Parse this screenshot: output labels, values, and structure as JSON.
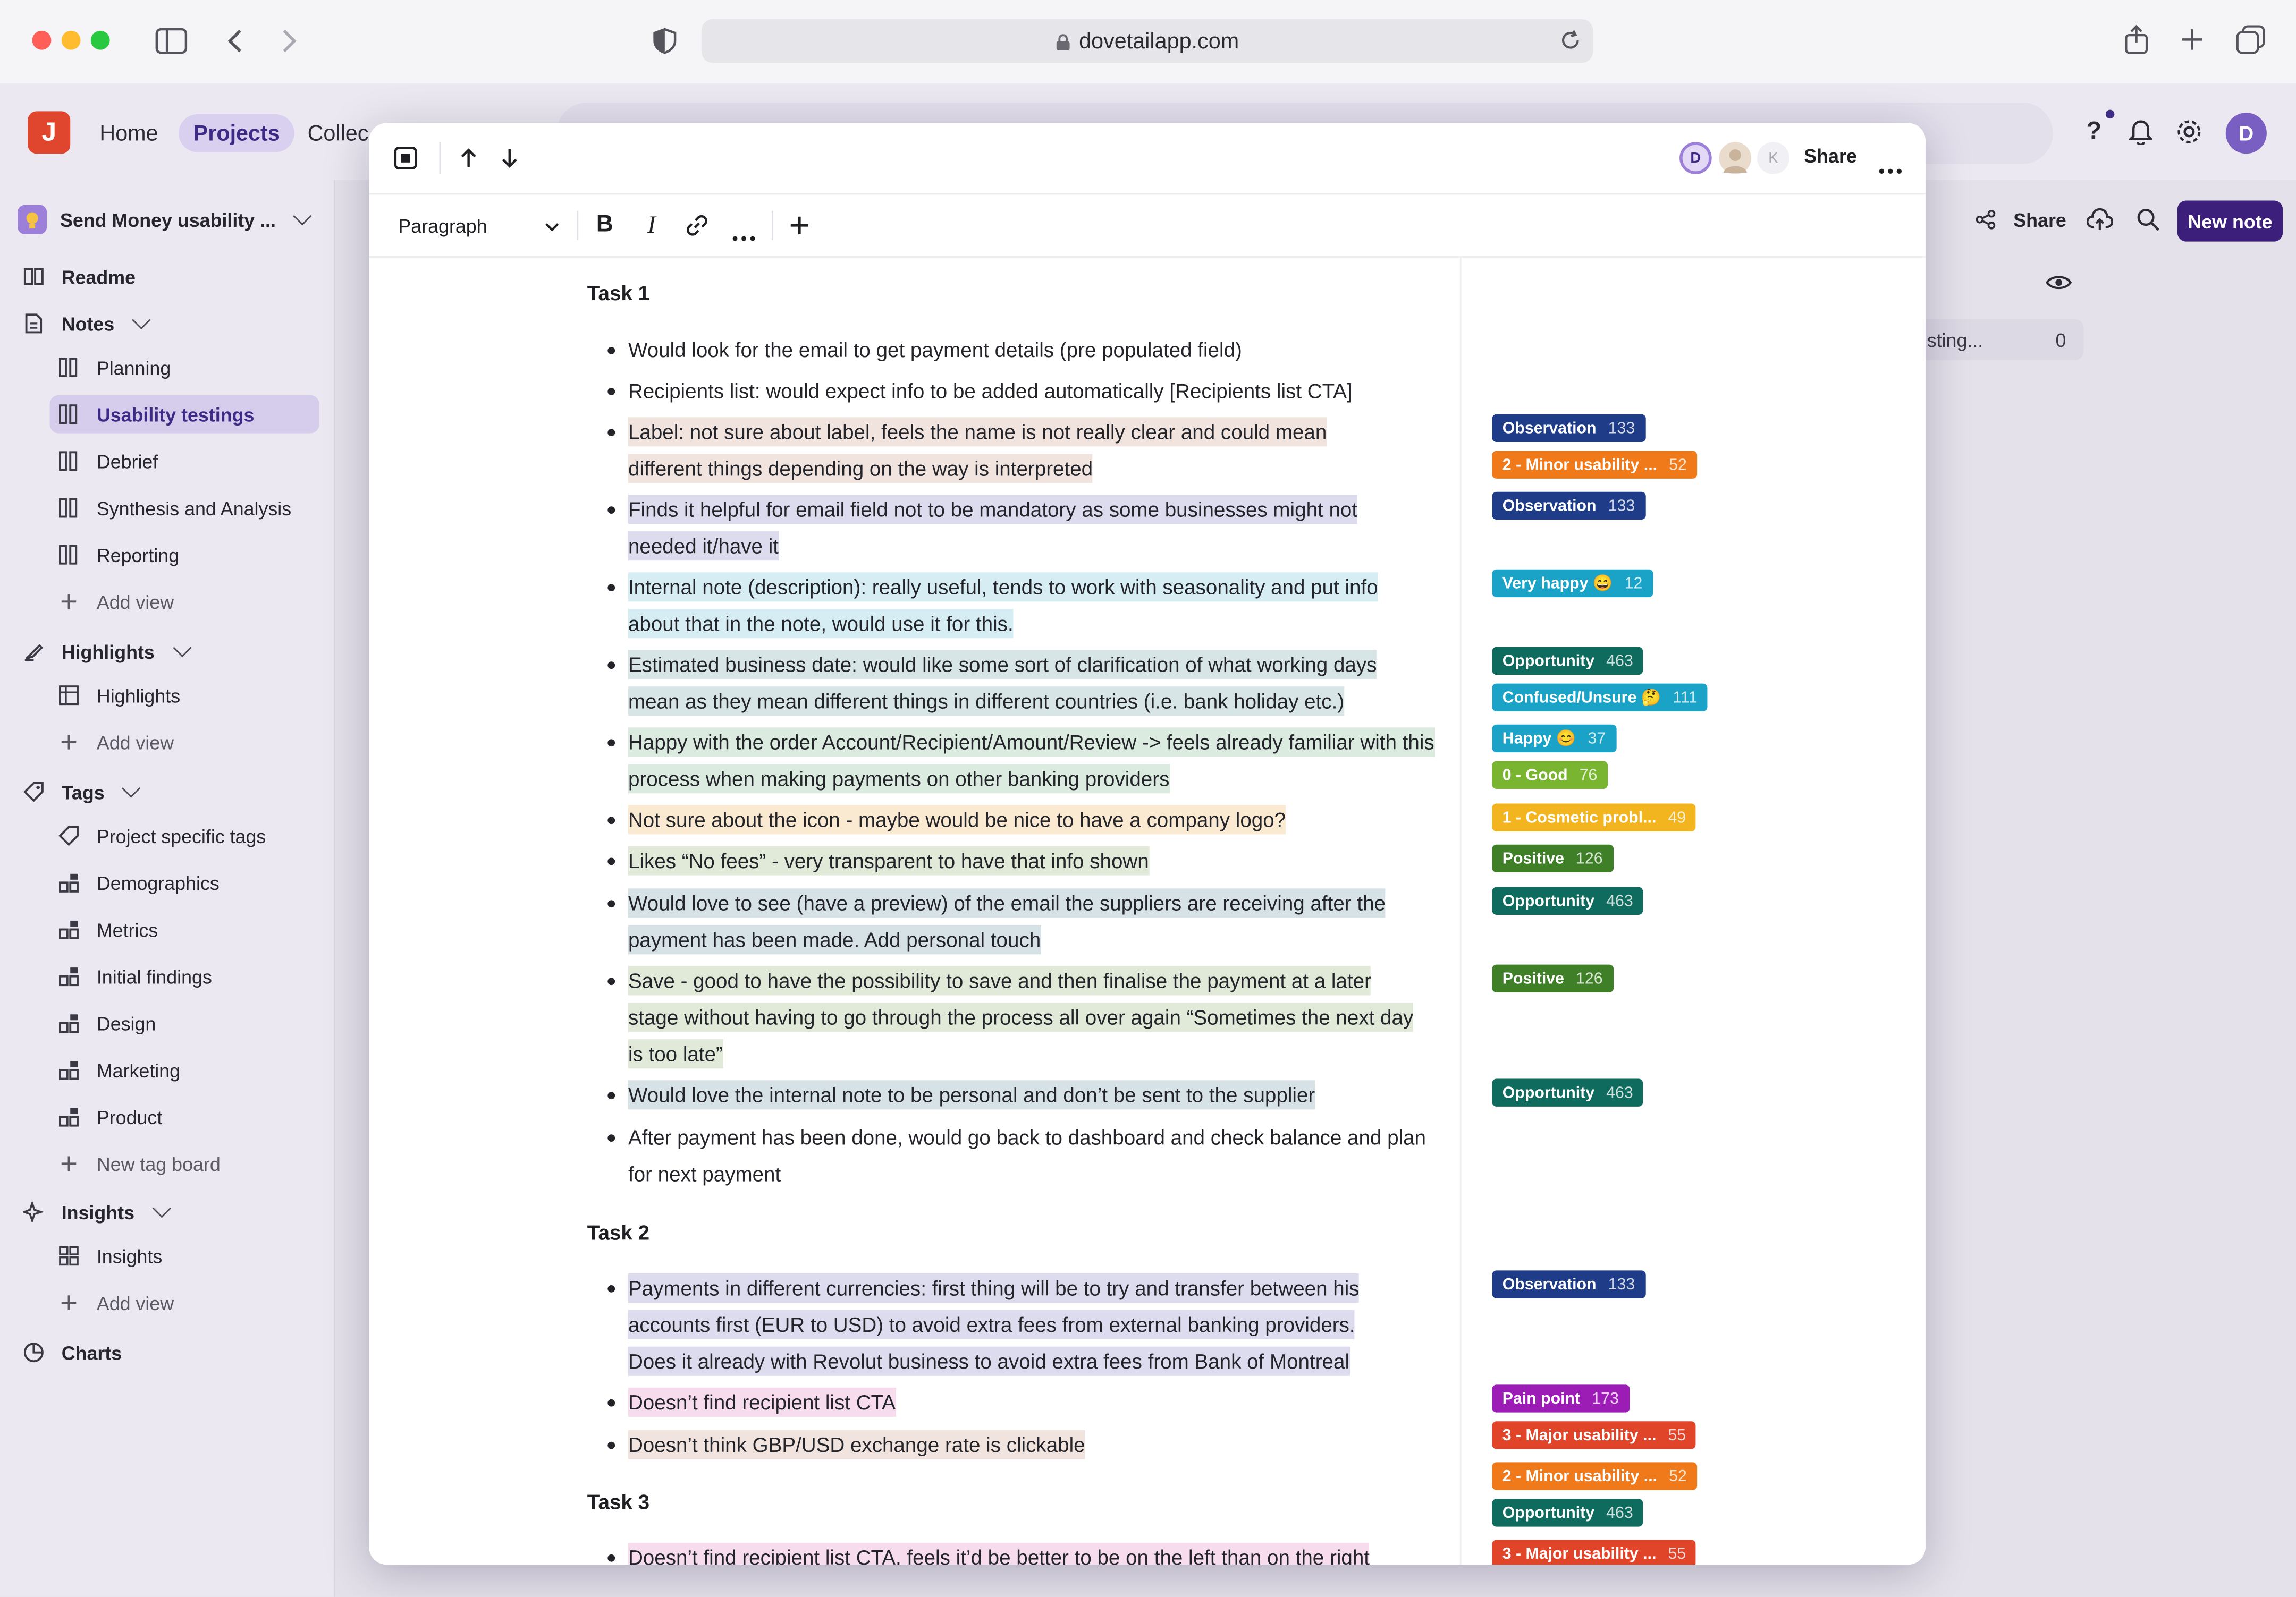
{
  "browser": {
    "url": "dovetailapp.com"
  },
  "app": {
    "logo_letter": "J",
    "nav": [
      "Home",
      "Projects",
      "Collec"
    ],
    "project_name": "Send Money usability ...",
    "actions": {
      "share": "Share",
      "new_note": "New note"
    },
    "avatar": "D",
    "bg_row": {
      "label": "sting...",
      "count": "0"
    }
  },
  "sidebar": {
    "readme": "Readme",
    "notes": "Notes",
    "note_views": [
      "Planning",
      "Usability testings",
      "Debrief",
      "Synthesis and Analysis",
      "Reporting"
    ],
    "add_view": "Add view",
    "highlights": "Highlights",
    "highlight_views": [
      "Highlights"
    ],
    "tags": "Tags",
    "tag_boards": [
      "Project specific tags",
      "Demographics",
      "Metrics",
      "Initial findings",
      "Design",
      "Marketing",
      "Product"
    ],
    "new_tag_board": "New tag board",
    "insights": "Insights",
    "insight_views": [
      "Insights"
    ],
    "charts": "Charts"
  },
  "modal": {
    "avatars": [
      "D",
      "",
      "K"
    ],
    "share": "Share",
    "format_select": "Paragraph"
  },
  "doc": {
    "task1": "Task 1",
    "task2": "Task 2",
    "task3": "Task 3",
    "items": [
      "Would look for the email to get payment details (pre populated field)",
      "Recipients list: would expect info to be added automatically [Recipients list CTA]",
      "Label: not sure about label, feels the name is not really clear and could mean different things depending on the way is interpreted",
      "Finds it helpful for email field not to be mandatory as some businesses might not needed it/have it",
      "Internal note (description): really useful, tends to work with seasonality and put info about that in the note, would use it for this.",
      "Estimated business date: would like some sort of clarification of what working days mean as they mean different things in different countries (i.e. bank holiday etc.)",
      "Happy with the order Account/Recipient/Amount/Review -> feels already familiar with this process when making payments on other banking providers",
      "Not sure about the icon - maybe would be nice to have a company logo?",
      "Likes “No fees” - very transparent to have that info shown",
      "Would love to see (have a preview) of the email the suppliers are receiving after the payment has been made. Add personal touch",
      "Save - good to have the possibility to save and then finalise the payment at a later stage without having to go through the process all over again “Sometimes the next day is too late”",
      "Would love the internal note to be personal and don’t be sent to the supplier",
      "After payment has been done, would go back to dashboard and check balance and plan for next payment",
      "Payments in different currencies: first thing will be to try and transfer between his accounts first (EUR to USD) to avoid extra fees from external banking providers. Does it already with Revolut business to avoid extra fees from Bank of Montreal",
      "Doesn’t find recipient list CTA",
      "Doesn’t think GBP/USD exchange rate is clickable",
      "Doesn’t find recipient list CTA, feels it’d be better to be on the left than on the right"
    ]
  },
  "tags": [
    {
      "name": "Observation",
      "count": "133",
      "color": "#1f3c88"
    },
    {
      "name": "2 - Minor usability ...",
      "count": "52",
      "color": "#f07a1a"
    },
    {
      "name": "Observation",
      "count": "133",
      "color": "#1f3c88"
    },
    {
      "name": "Very happy 😄",
      "count": "12",
      "color": "#1aa3c7"
    },
    {
      "name": "Opportunity",
      "count": "463",
      "color": "#0f6b5e"
    },
    {
      "name": "Confused/Unsure 🤔",
      "count": "111",
      "color": "#1aa3c7"
    },
    {
      "name": "Happy 😊",
      "count": "37",
      "color": "#1aa3c7"
    },
    {
      "name": "0 - Good",
      "count": "76",
      "color": "#7ab532"
    },
    {
      "name": "1 - Cosmetic probl...",
      "count": "49",
      "color": "#f2b51f"
    },
    {
      "name": "Positive",
      "count": "126",
      "color": "#3f7f28"
    },
    {
      "name": "Opportunity",
      "count": "463",
      "color": "#0f6b5e"
    },
    {
      "name": "Positive",
      "count": "126",
      "color": "#3f7f28"
    },
    {
      "name": "Opportunity",
      "count": "463",
      "color": "#0f6b5e"
    },
    {
      "name": "Observation",
      "count": "133",
      "color": "#1f3c88"
    },
    {
      "name": "Pain point",
      "count": "173",
      "color": "#9c1db5"
    },
    {
      "name": "3 - Major usability ...",
      "count": "55",
      "color": "#e0452a"
    },
    {
      "name": "2 - Minor usability ...",
      "count": "52",
      "color": "#f07a1a"
    },
    {
      "name": "Opportunity",
      "count": "463",
      "color": "#0f6b5e"
    },
    {
      "name": "3 - Major usability ...",
      "count": "55",
      "color": "#e0452a"
    }
  ]
}
